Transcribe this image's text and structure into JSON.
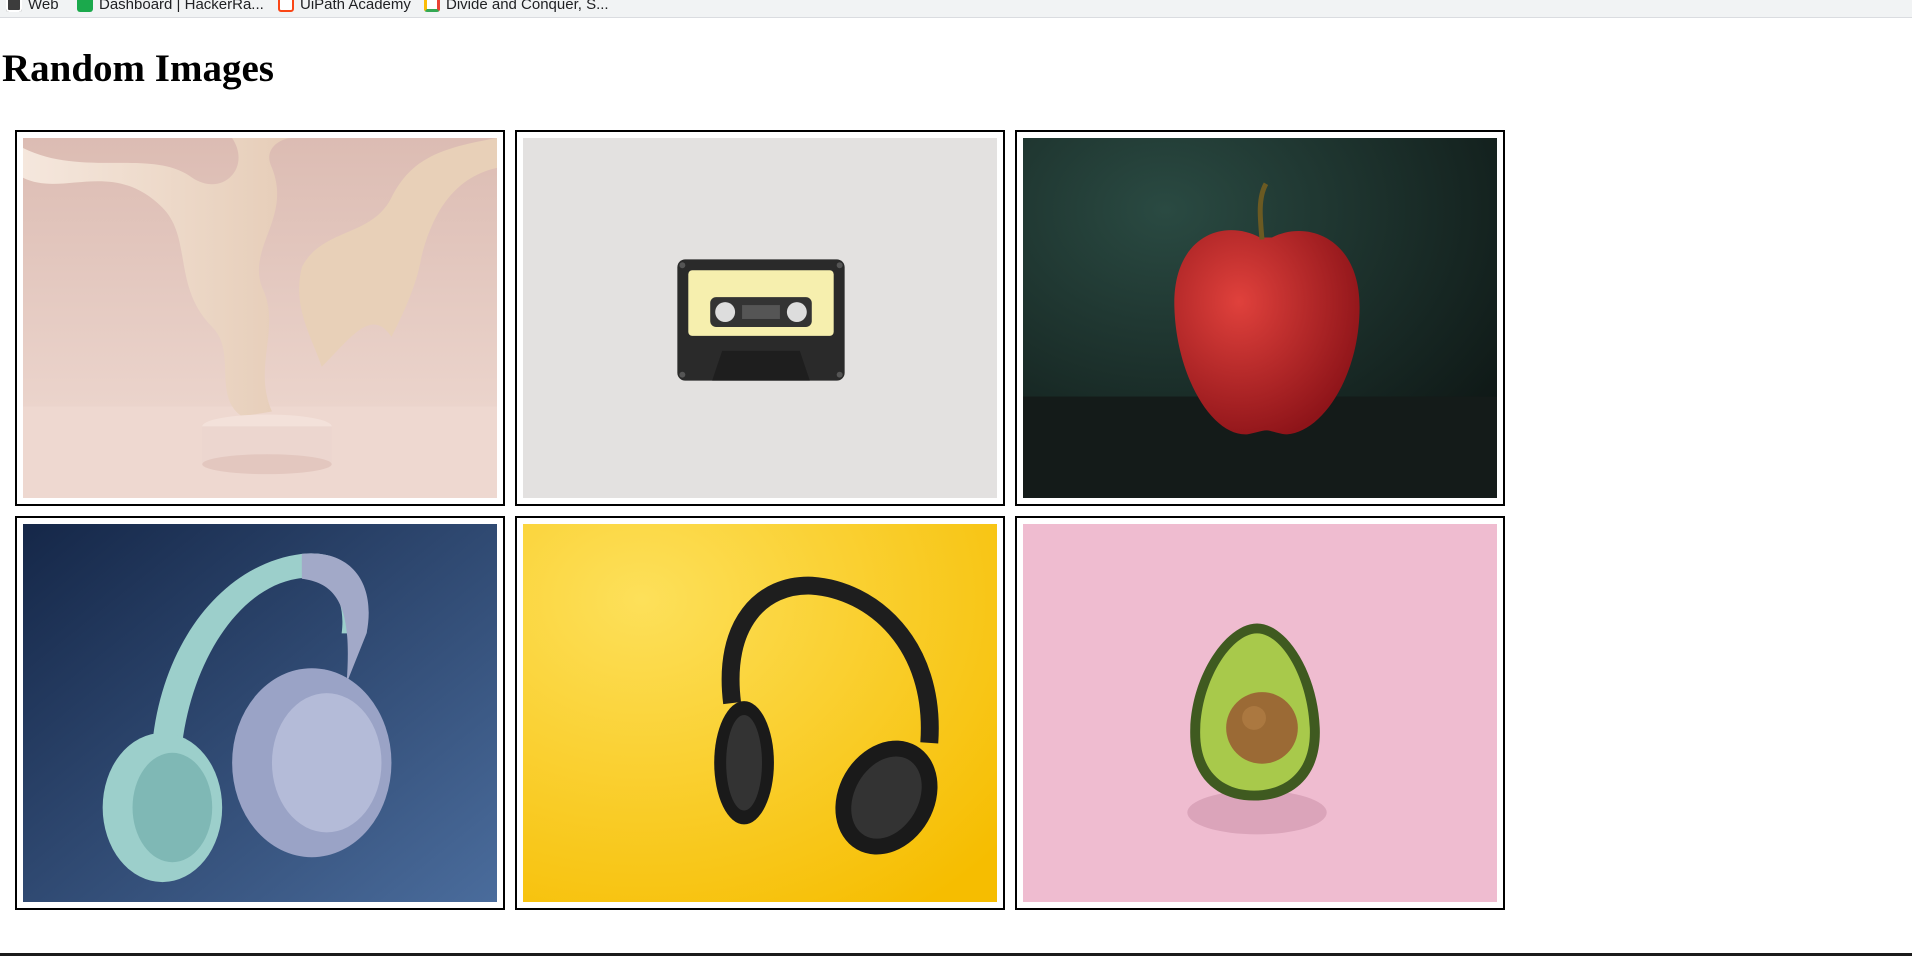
{
  "bookmarks": [
    {
      "label": "Web",
      "icon": "wordpress-icon"
    },
    {
      "label": "Dashboard | HackerRa...",
      "icon": "hackerrank-icon"
    },
    {
      "label": "UiPath Academy",
      "icon": "uipath-icon"
    },
    {
      "label": "Divide and Conquer, S...",
      "icon": "google-icon"
    }
  ],
  "page": {
    "title": "Random Images"
  },
  "images": [
    {
      "subject": "abstract cream liquid sculpture with pedestal",
      "colors": {
        "bg": "#e3c8c0",
        "accent": "#efdccc"
      }
    },
    {
      "subject": "cassette tape on light grey background",
      "colors": {
        "bg": "#e2e0df",
        "accent": "#f6efae"
      }
    },
    {
      "subject": "red apple on dark green background",
      "colors": {
        "bg": "#1c2e2a",
        "accent": "#c0222a"
      }
    },
    {
      "subject": "teal and lavender headphones on navy background",
      "colors": {
        "bg": "#2e4a78",
        "accent": "#9ccfcb"
      }
    },
    {
      "subject": "black headphones on yellow background",
      "colors": {
        "bg": "#fcc514",
        "accent": "#1e1e1e"
      }
    },
    {
      "subject": "halved avocado on pink background",
      "colors": {
        "bg": "#efbcd0",
        "accent": "#8bb43a"
      }
    }
  ]
}
